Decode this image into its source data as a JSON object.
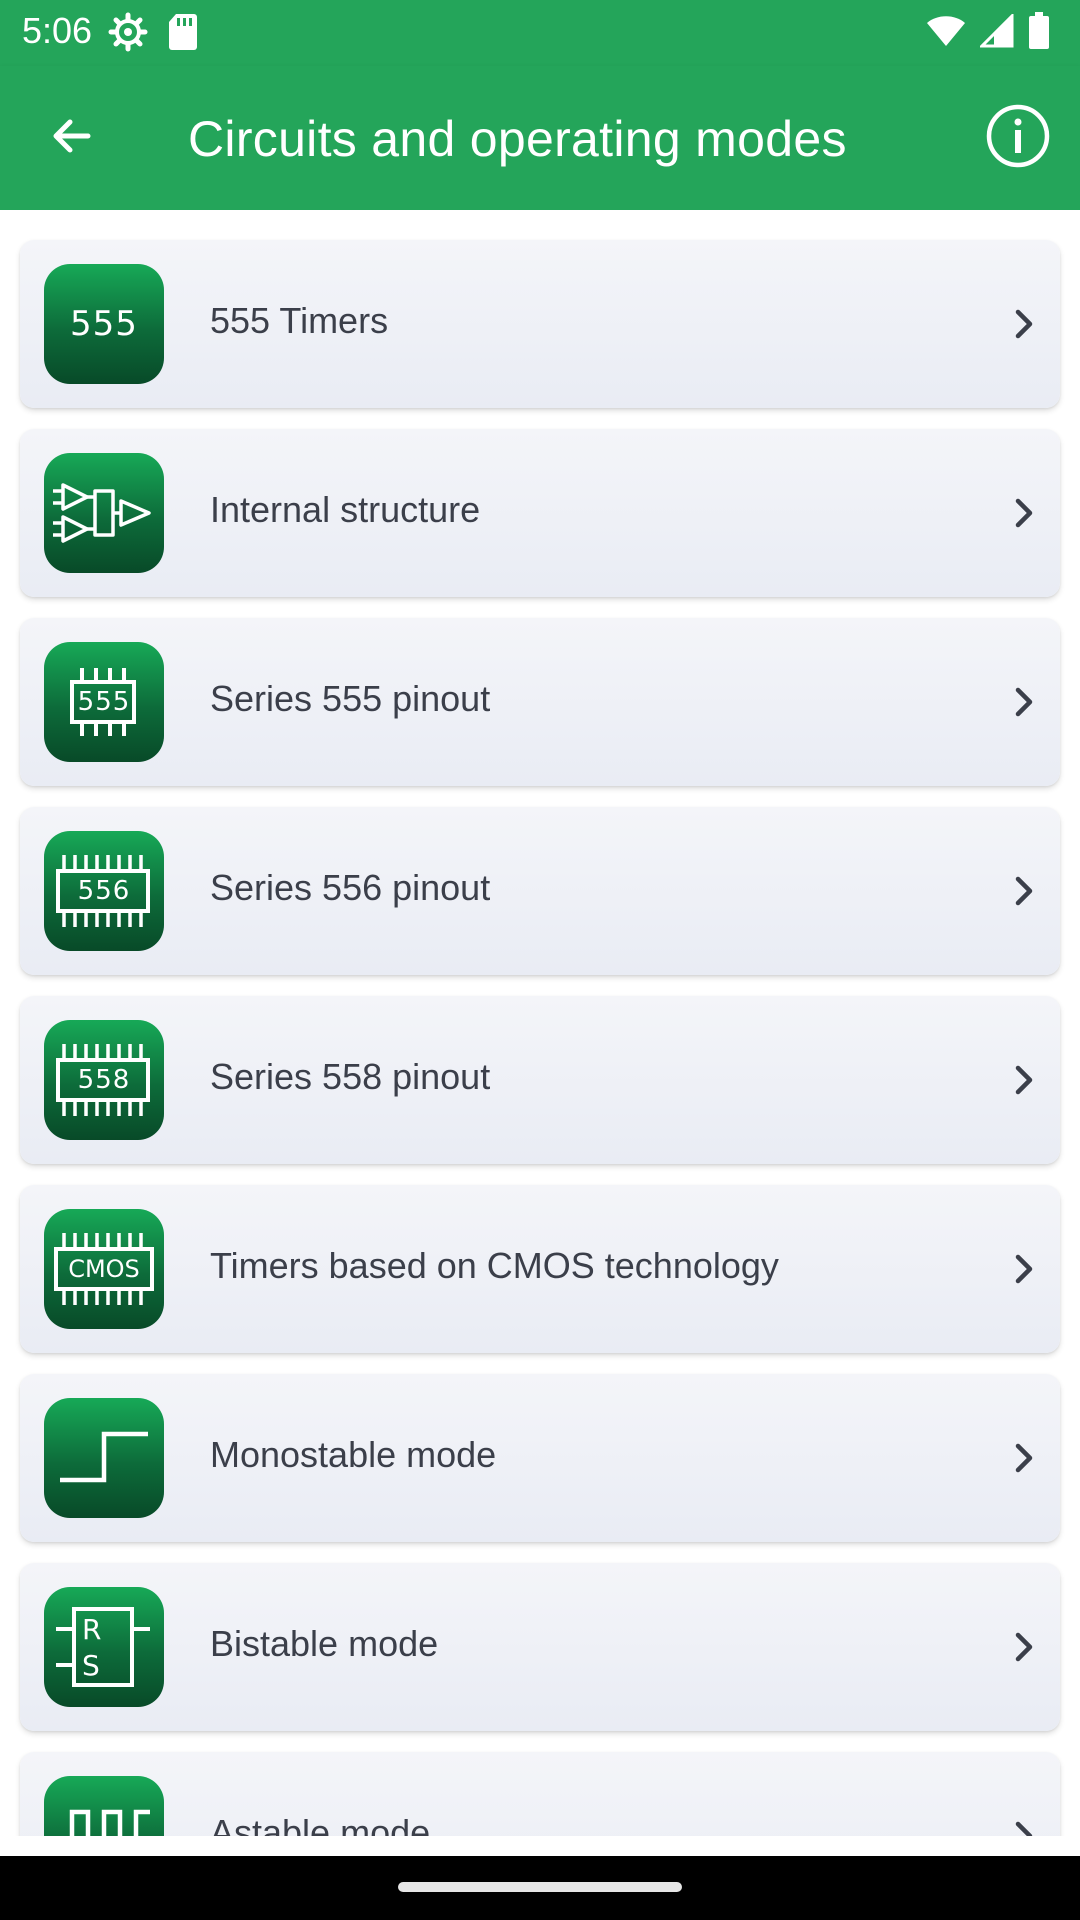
{
  "status_bar": {
    "time": "5:06",
    "icons": [
      "settings-gear-icon",
      "sd-card-icon",
      "wifi-icon",
      "signal-icon",
      "battery-icon"
    ]
  },
  "app_bar": {
    "title": "Circuits and operating modes",
    "back_icon": "arrow-back-icon",
    "info_icon": "info-icon"
  },
  "colors": {
    "primary": "#24a55a",
    "icon_gradient_top": "#17a957",
    "icon_gradient_bottom": "#084a28",
    "card_bg": "#eef0f6",
    "label_text": "#3b3f4a"
  },
  "items": [
    {
      "label": "555 Timers",
      "icon": "text-555-icon",
      "icon_text": "555"
    },
    {
      "label": "Internal structure",
      "icon": "comparator-flipflop-icon"
    },
    {
      "label": "Series 555 pinout",
      "icon": "chip-555-icon",
      "icon_text": "555"
    },
    {
      "label": "Series 556 pinout",
      "icon": "chip-556-icon",
      "icon_text": "556"
    },
    {
      "label": "Series 558 pinout",
      "icon": "chip-558-icon",
      "icon_text": "558"
    },
    {
      "label": "Timers based on CMOS technology",
      "icon": "chip-cmos-icon",
      "icon_text": "CMOS"
    },
    {
      "label": "Monostable mode",
      "icon": "step-waveform-icon"
    },
    {
      "label": "Bistable mode",
      "icon": "rs-flipflop-icon",
      "icon_text_r": "R",
      "icon_text_s": "S"
    },
    {
      "label": "Astable mode",
      "icon": "square-wave-icon"
    }
  ]
}
